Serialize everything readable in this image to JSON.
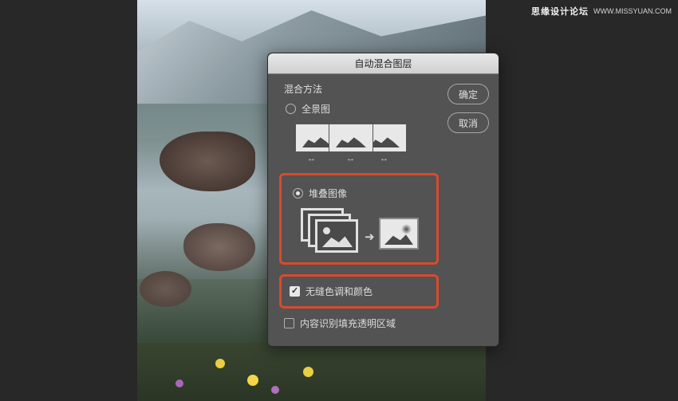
{
  "watermark": {
    "logo": "思缘设计论坛",
    "url": "WWW.MISSYUAN.COM"
  },
  "dialog": {
    "title": "自动混合图层",
    "section_label": "混合方法",
    "panorama": {
      "label": "全景图",
      "selected": false
    },
    "stack": {
      "label": "堆叠图像",
      "selected": true
    },
    "seamless": {
      "label": "无缝色调和颜色",
      "checked": true
    },
    "content_aware": {
      "label": "内容识别填充透明区域",
      "checked": false
    },
    "ok": "确定",
    "cancel": "取消"
  },
  "colors": {
    "highlight": "#d94a2e",
    "dialog_bg": "#535353",
    "app_bg": "#282828"
  }
}
